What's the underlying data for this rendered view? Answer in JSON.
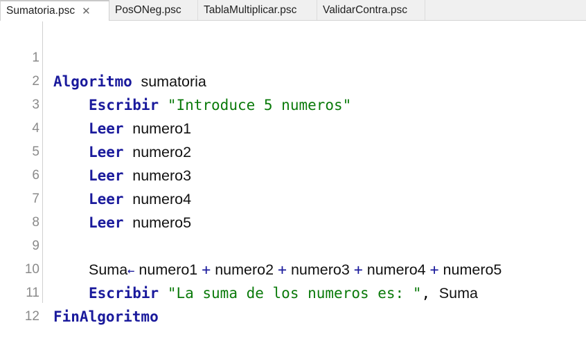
{
  "tabs": [
    {
      "label": "Sumatoria.psc",
      "active": true,
      "close": "✕"
    },
    {
      "label": "PosONeg.psc",
      "active": false
    },
    {
      "label": "TablaMultiplicar.psc",
      "active": false
    },
    {
      "label": "ValidarContra.psc",
      "active": false
    }
  ],
  "editor": {
    "line_numbers": [
      "1",
      "2",
      "3",
      "4",
      "5",
      "6",
      "7",
      "8",
      "9",
      "10",
      "11",
      "12"
    ],
    "lines": {
      "l1": {
        "kw": "Algoritmo",
        "name": "sumatoria"
      },
      "l2": {
        "kw": "Escribir",
        "str": "\"Introduce 5 numeros\""
      },
      "l3": {
        "kw": "Leer",
        "var": "numero1"
      },
      "l4": {
        "kw": "Leer",
        "var": "numero2"
      },
      "l5": {
        "kw": "Leer",
        "var": "numero3"
      },
      "l6": {
        "kw": "Leer",
        "var": "numero4"
      },
      "l7": {
        "kw": "Leer",
        "var": "numero5"
      },
      "l9": {
        "target": "Suma",
        "assign": "←",
        "v1": "numero1",
        "plus": "+",
        "v2": "numero2",
        "v3": "numero3",
        "v4": "numero4",
        "v5": "numero5"
      },
      "l10": {
        "kw": "Escribir",
        "str": "\"La suma de los numeros es: \"",
        "comma": ",",
        "var": "Suma"
      },
      "l11": {
        "kw": "FinAlgoritmo"
      }
    }
  },
  "colors": {
    "keyword": "#1a1a9c",
    "string": "#0a7a0a",
    "line_number": "#8a8a8a"
  }
}
